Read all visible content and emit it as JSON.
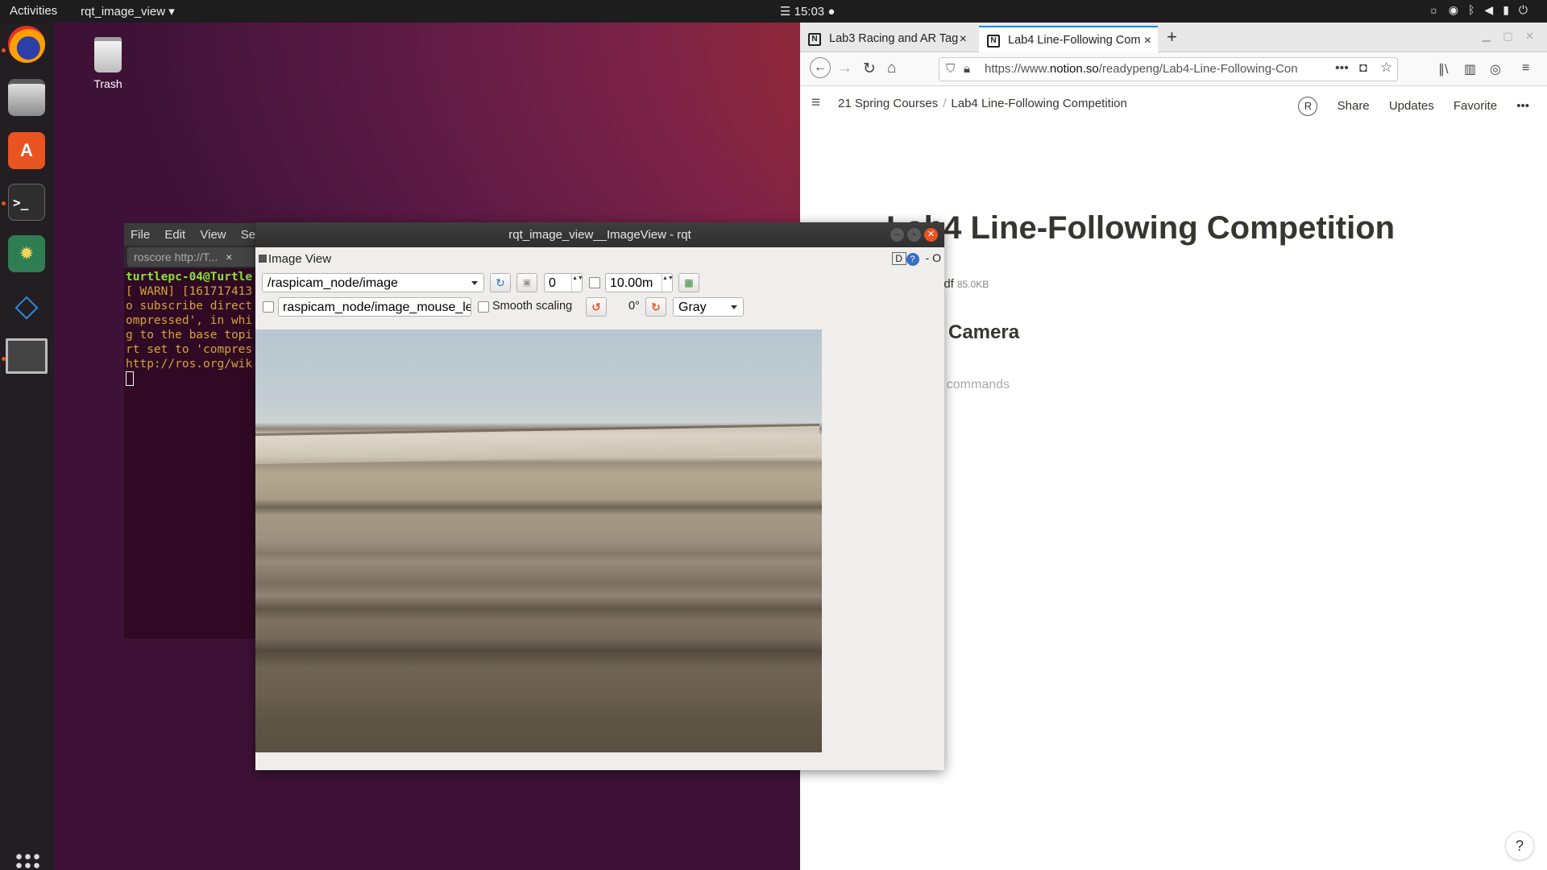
{
  "topbar": {
    "activities": "Activities",
    "app_menu": "rqt_image_view ▾",
    "clock": "☰ 15:03 ●",
    "tray_icons": [
      "weather-icon",
      "wifi-icon",
      "bluetooth-icon",
      "volume-icon",
      "battery-icon",
      "power-icon"
    ]
  },
  "dock": {
    "items": [
      "firefox-icon",
      "files-icon",
      "software-icon",
      "terminal-icon",
      "settings-icon",
      "vscode-icon",
      "rqt-window-icon"
    ],
    "terminal_glyph": ">_",
    "software_glyph": "A",
    "vscode_glyph": "◇",
    "settings_glyph": "✹"
  },
  "desktop": {
    "trash_label": "Trash"
  },
  "terminal": {
    "menu": [
      "File",
      "Edit",
      "View",
      "Search"
    ],
    "tab_label": "roscore http://T...",
    "tab_close": "×",
    "prompt": "turtlepc-04@Turtle",
    "lines": [
      "[ WARN] [161717413",
      "o subscribe direct",
      "ompressed', in whi",
      "g to the base topi",
      "rt set to 'compres",
      "http://ros.org/wik"
    ]
  },
  "browser": {
    "tabs": [
      {
        "title": "Lab3 Racing and AR Tag",
        "icon": "N",
        "close": "×"
      },
      {
        "title": "Lab4 Line-Following Com",
        "icon": "N",
        "close": "×"
      }
    ],
    "new_tab": "+",
    "url_prefix": "https://www.",
    "url_host": "notion.so",
    "url_path": "/readypeng/Lab4-Line-Following-Con",
    "breadcrumb": [
      "21 Spring Courses",
      "Lab4 Line-Following Competition"
    ],
    "breadcrumb_sep": "/",
    "avatar_letter": "R",
    "actions": [
      "Share",
      "Updates",
      "Favorite",
      "•••"
    ],
    "page_title": "Lab4 Line-Following Competition",
    "attachment_name": "pdf",
    "attachment_size": "85.0KB",
    "heading": "Camera",
    "placeholder": "r commands",
    "help": "?"
  },
  "rqt": {
    "window_title": "rqt_image_view__ImageView - rqt",
    "plugin_title": "Image View",
    "plugin_right_d": "D",
    "plugin_right_q": "?",
    "plugin_right_dash": "- O",
    "topic": "/raspicam_node/image",
    "spin_value": "0",
    "spin_arrows": "▲▼",
    "duration_value": "10.00m",
    "mouse_topic": "raspicam_node/image_mouse_left",
    "smooth_scaling_label": "Smooth scaling",
    "rotation": "0°",
    "color_scheme": "Gray",
    "refresh_glyph": "↻",
    "rotate_left_glyph": "↺",
    "rotate_right_glyph": "↻",
    "fit_glyph": "▣",
    "save_glyph": "▦"
  }
}
